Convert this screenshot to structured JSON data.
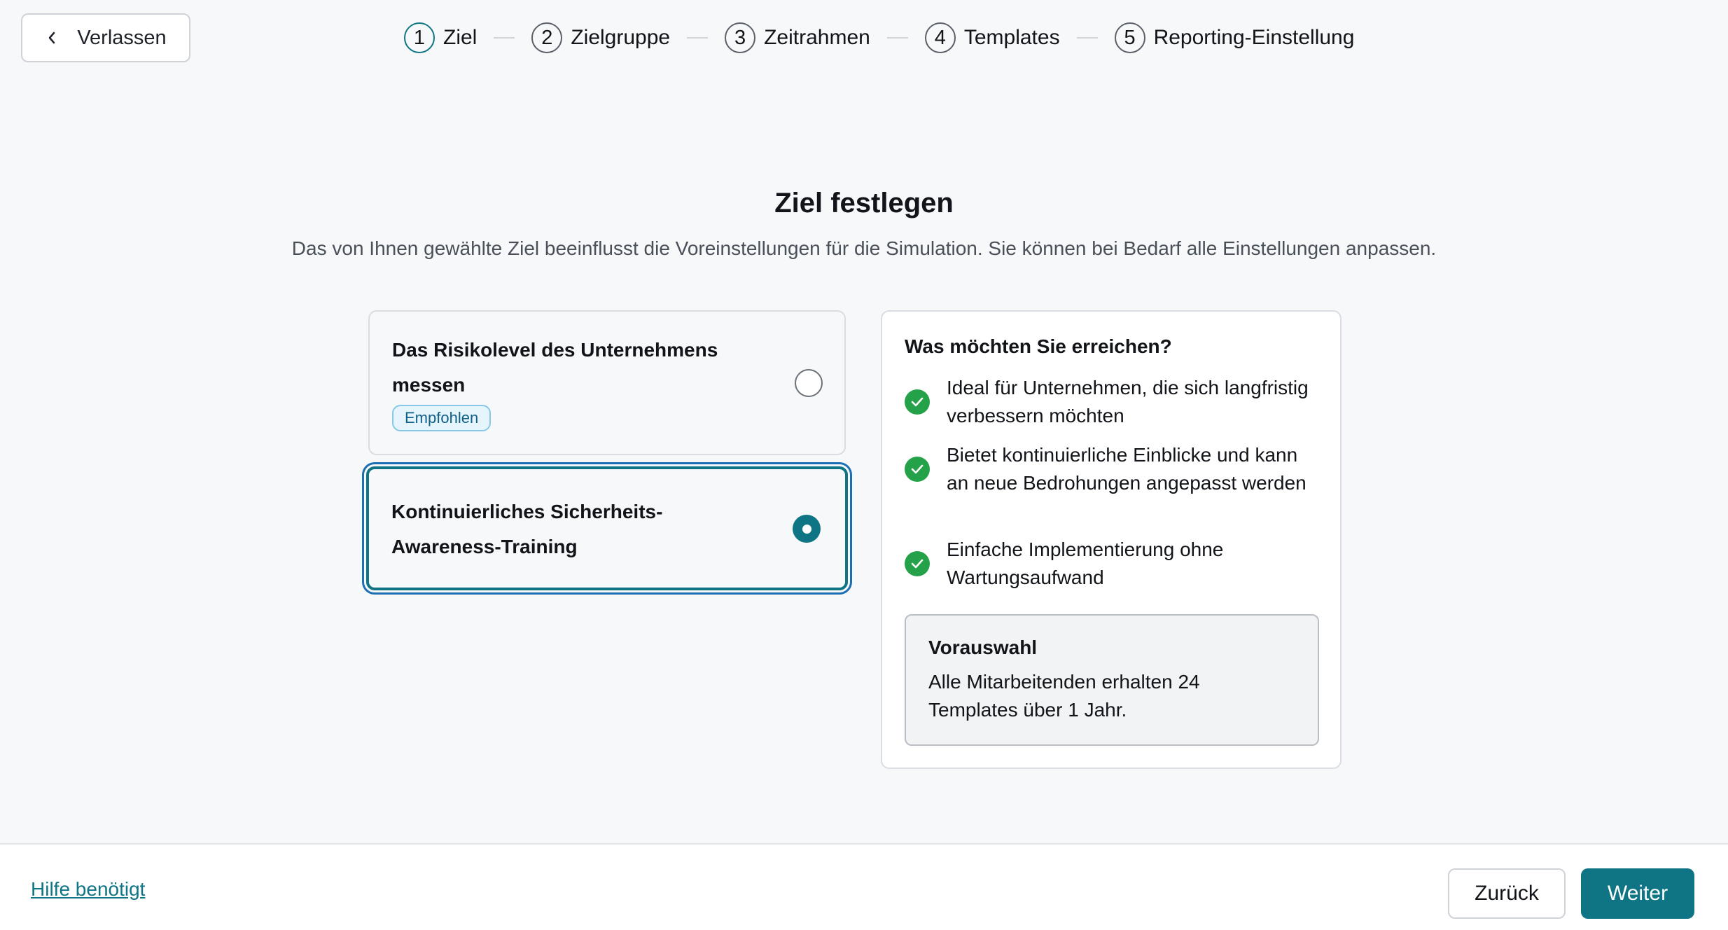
{
  "header": {
    "exit_label": "Verlassen",
    "exit_icon": "chevron-left-icon",
    "steps": [
      {
        "number": "1",
        "label": "Ziel",
        "active": true
      },
      {
        "number": "2",
        "label": "Zielgruppe",
        "active": false
      },
      {
        "number": "3",
        "label": "Zeitrahmen",
        "active": false
      },
      {
        "number": "4",
        "label": "Templates",
        "active": false
      },
      {
        "number": "5",
        "label": "Reporting-Einstellung",
        "active": false
      }
    ]
  },
  "main": {
    "title": "Ziel festlegen",
    "subtitle": "Das von Ihnen gewählte Ziel beeinflusst die Voreinstellungen für die Simulation. Sie können bei Bedarf alle Einstellungen anpassen.",
    "options": [
      {
        "title": "Das Risikolevel des Unternehmens messen",
        "badge": "Empfohlen",
        "selected": false
      },
      {
        "title": "Kontinuierliches Sicherheits-Awareness-Training",
        "selected": true
      }
    ],
    "info": {
      "title": "Was möchten Sie erreichen?",
      "benefits": [
        "Ideal für Unternehmen, die sich langfristig verbessern möchten",
        "Bietet kontinuierliche Einblicke und kann an neue Bedrohungen angepasst werden",
        "Einfache Implementierung ohne Wartungsaufwand"
      ],
      "preset": {
        "title": "Vorauswahl",
        "text": "Alle Mitarbeitenden erhalten 24 Templates über 1 Jahr."
      }
    }
  },
  "footer": {
    "help_label": "Hilfe benötigt",
    "back_label": "Zurück",
    "next_label": "Weiter"
  },
  "colors": {
    "accent": "#0f7484",
    "check_green": "#25a249",
    "badge_bg": "#e6f5fb",
    "selected_outline": "#1d6fb3"
  }
}
